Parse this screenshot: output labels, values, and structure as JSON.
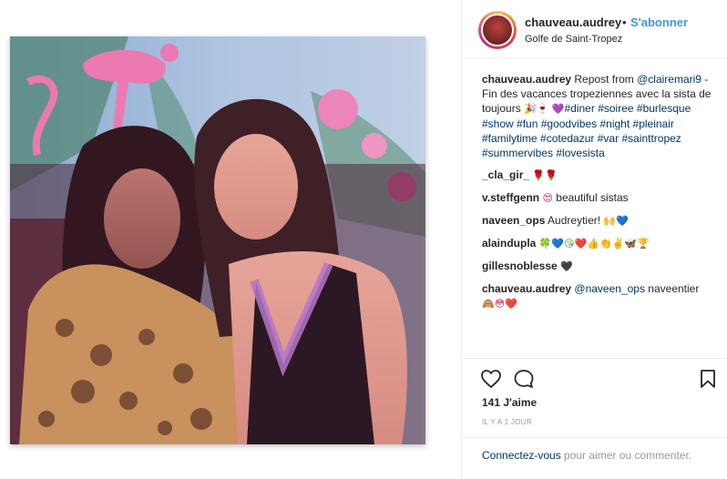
{
  "header": {
    "username": "chauveau.audrey",
    "separator": "•",
    "follow_label": "S'abonner",
    "location": "Golfe de Saint-Tropez"
  },
  "caption": {
    "username": "chauveau.audrey",
    "repost_text": "Repost from",
    "mention": "@clairemari9",
    "text": " - Fin des vacances tropeziennes avec la sista de toujours ",
    "emoji_after_text": "🎉🍷",
    "emoji_before_tags": "💜",
    "hashtags": [
      "#diner",
      "#soiree",
      "#burlesque",
      "#show",
      "#fun",
      "#goodvibes",
      "#night",
      "#pleinair",
      "#familytime",
      "#cotedazur",
      "#var",
      "#sainttropez",
      "#summervibes",
      "#lovesista"
    ]
  },
  "comments": [
    {
      "username": "_cla_gir_",
      "text": "",
      "emoji": "🌹🌹"
    },
    {
      "username": "v.steffgenn",
      "text": " beautiful sistas",
      "emoji": "😍"
    },
    {
      "username": "naveen_ops",
      "text": "Audreytier! ",
      "emoji": "🙌💙"
    },
    {
      "username": "alaindupla",
      "text": "",
      "emoji": "🍀💙😘❤️👍👏✌️🦋🏆"
    },
    {
      "username": "gillesnoblesse",
      "text": "",
      "emoji": "🖤"
    },
    {
      "username": "chauveau.audrey",
      "mention": "@naveen_ops",
      "text": " naveentier",
      "emoji": "🙈😳❤️"
    }
  ],
  "actions": {
    "like_icon": "heart-outline-icon",
    "comment_icon": "comment-bubble-icon",
    "save_icon": "bookmark-icon",
    "likes_label": "141 J'aime",
    "time_label": "IL Y A 1 JOUR"
  },
  "login_prompt": {
    "link_text": "Connectez-vous",
    "rest_text": " pour aimer ou commenter."
  },
  "colors": {
    "link_blue": "#3897f0",
    "tag_blue": "#003569",
    "muted": "#999999",
    "text": "#262626",
    "border": "#efefef"
  }
}
